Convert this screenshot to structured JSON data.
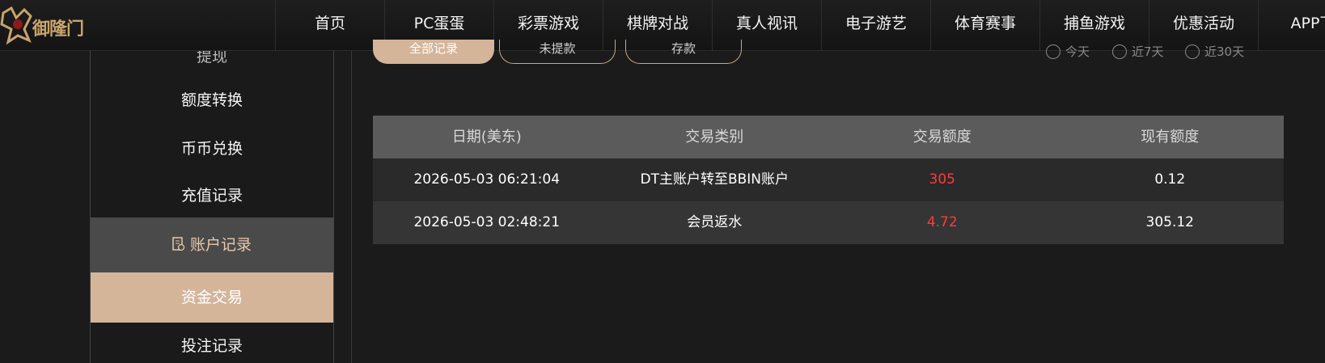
{
  "brand": {
    "name": "御隆门",
    "accent": "#c9a46b"
  },
  "nav": [
    {
      "label": "首页"
    },
    {
      "label": "PC蛋蛋"
    },
    {
      "label": "彩票游戏"
    },
    {
      "label": "棋牌对战"
    },
    {
      "label": "真人视讯"
    },
    {
      "label": "电子游艺"
    },
    {
      "label": "体育赛事"
    },
    {
      "label": "捕鱼游戏"
    },
    {
      "label": "优惠活动"
    },
    {
      "label": "APP下"
    }
  ],
  "sidebar": {
    "items": [
      {
        "label": "提现"
      },
      {
        "label": "额度转换"
      },
      {
        "label": "币币兑换"
      },
      {
        "label": "充值记录"
      }
    ],
    "group": {
      "label": "账户记录",
      "icon": "document-icon"
    },
    "active": {
      "label": "资金交易"
    },
    "after": [
      {
        "label": "投注记录"
      }
    ]
  },
  "filters": {
    "tabs": [
      {
        "label": "全部记录"
      },
      {
        "label": "未提款"
      },
      {
        "label": "存款"
      }
    ],
    "ranges": [
      {
        "label": "今天"
      },
      {
        "label": "近7天"
      },
      {
        "label": "近30天"
      }
    ]
  },
  "table": {
    "headers": [
      "日期(美东)",
      "交易类别",
      "交易额度",
      "现有额度"
    ],
    "rows": [
      {
        "date": "2026-05-03 06:21:04",
        "type": "DT主账户转至BBIN账户",
        "amount": "305",
        "balance": "0.12"
      },
      {
        "date": "2026-05-03 02:48:21",
        "type": "会员返水",
        "amount": "4.72",
        "balance": "305.12"
      }
    ]
  }
}
